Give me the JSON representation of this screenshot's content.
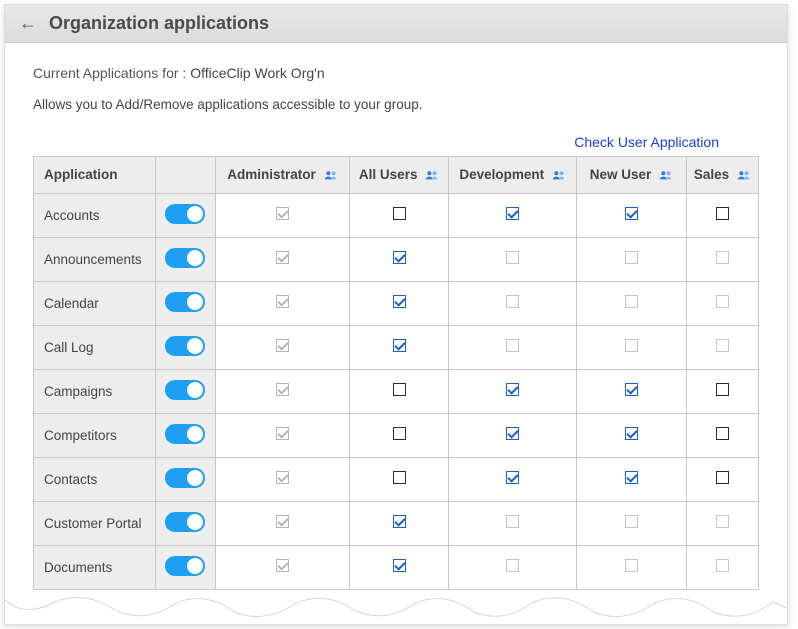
{
  "header": {
    "title": "Organization applications"
  },
  "subheader": {
    "label": "Current Applications for :",
    "org": "OfficeClip Work Org'n"
  },
  "description": "Allows you to Add/Remove applications accessible to your group.",
  "link": {
    "check_user_application": "Check User Application"
  },
  "columns": {
    "application": "Application",
    "administrator": "Administrator",
    "all_users": "All Users",
    "development": "Development",
    "new_user": "New User",
    "sales": "Sales"
  },
  "rows": [
    {
      "app": "Accounts",
      "toggle": true,
      "admin": "checked-grey",
      "all": "empty-black",
      "dev": "checked-blue",
      "new": "checked-blue",
      "sales": "empty-black"
    },
    {
      "app": "Announcements",
      "toggle": true,
      "admin": "checked-grey",
      "all": "checked-blue",
      "dev": "empty-grey",
      "new": "empty-grey",
      "sales": "empty-grey"
    },
    {
      "app": "Calendar",
      "toggle": true,
      "admin": "checked-grey",
      "all": "checked-blue",
      "dev": "empty-grey",
      "new": "empty-grey",
      "sales": "empty-grey"
    },
    {
      "app": "Call Log",
      "toggle": true,
      "admin": "checked-grey",
      "all": "checked-blue",
      "dev": "empty-grey",
      "new": "empty-grey",
      "sales": "empty-grey"
    },
    {
      "app": "Campaigns",
      "toggle": true,
      "admin": "checked-grey",
      "all": "empty-black",
      "dev": "checked-blue",
      "new": "checked-blue",
      "sales": "empty-black"
    },
    {
      "app": "Competitors",
      "toggle": true,
      "admin": "checked-grey",
      "all": "empty-black",
      "dev": "checked-blue",
      "new": "checked-blue",
      "sales": "empty-black"
    },
    {
      "app": "Contacts",
      "toggle": true,
      "admin": "checked-grey",
      "all": "empty-black",
      "dev": "checked-blue",
      "new": "checked-blue",
      "sales": "empty-black"
    },
    {
      "app": "Customer Portal",
      "toggle": true,
      "admin": "checked-grey",
      "all": "checked-blue",
      "dev": "empty-grey",
      "new": "empty-grey",
      "sales": "empty-grey"
    },
    {
      "app": "Documents",
      "toggle": true,
      "admin": "checked-grey",
      "all": "checked-blue",
      "dev": "empty-grey",
      "new": "empty-grey",
      "sales": "empty-grey"
    }
  ]
}
